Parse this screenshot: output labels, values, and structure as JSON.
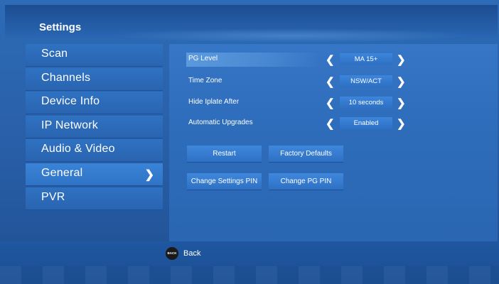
{
  "header": {
    "title": "Settings"
  },
  "sidebar": {
    "items": [
      {
        "label": "Scan"
      },
      {
        "label": "Channels"
      },
      {
        "label": "Device Info"
      },
      {
        "label": "IP Network"
      },
      {
        "label": "Audio & Video"
      },
      {
        "label": "General",
        "selected": true
      },
      {
        "label": "PVR"
      }
    ]
  },
  "settings": {
    "rows": [
      {
        "label": "PG Level",
        "value": "MA 15+",
        "highlighted": true
      },
      {
        "label": "Time Zone",
        "value": "NSW/ACT"
      },
      {
        "label": "Hide Iplate After",
        "value": "10 seconds"
      },
      {
        "label": "Automatic Upgrades",
        "value": "Enabled"
      }
    ],
    "buttons": {
      "restart": "Restart",
      "factory_defaults": "Factory Defaults",
      "change_settings_pin": "Change Settings PIN",
      "change_pg_pin": "Change PG PIN"
    }
  },
  "footer": {
    "back_icon_text": "BACK",
    "back_label": "Back"
  },
  "icons": {
    "left_arrow": "chevron-left-icon",
    "right_arrow": "chevron-right-icon",
    "submenu": "chevron-right-icon"
  },
  "colors": {
    "background": "#2a62ab",
    "menu_item": "#2f72c2",
    "selected_item": "#3a83d6",
    "value_box": "#3c86dc",
    "button": "#3f88dc"
  }
}
